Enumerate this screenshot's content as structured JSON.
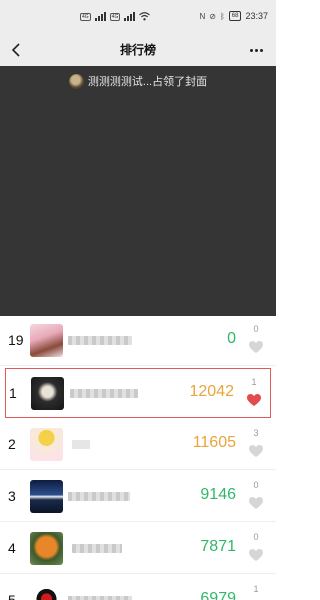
{
  "status_bar": {
    "sim1": "4G",
    "sim2": "4G",
    "battery": "68",
    "time": "23:37"
  },
  "nav": {
    "title": "排行榜",
    "back_icon": "chevron-left-icon",
    "more_icon": "more-dots-icon"
  },
  "cover": {
    "caption": "测测测测试...占领了封面",
    "background": "#353535"
  },
  "colors": {
    "orange": "#e9a43a",
    "green": "#2fb86a",
    "heart_active": "#e24c4c",
    "heart_inactive": "#d6d6d6",
    "highlight_border": "#e25a5a"
  },
  "ranking": [
    {
      "rank": "19",
      "steps": "0",
      "likes": "0",
      "liked": false,
      "highlighted": false,
      "color": "green"
    },
    {
      "rank": "1",
      "steps": "12042",
      "likes": "1",
      "liked": true,
      "highlighted": true,
      "color": "orange"
    },
    {
      "rank": "2",
      "steps": "11605",
      "likes": "3",
      "liked": false,
      "highlighted": false,
      "color": "orange"
    },
    {
      "rank": "3",
      "steps": "9146",
      "likes": "0",
      "liked": false,
      "highlighted": false,
      "color": "green"
    },
    {
      "rank": "4",
      "steps": "7871",
      "likes": "0",
      "liked": false,
      "highlighted": false,
      "color": "green"
    },
    {
      "rank": "5",
      "steps": "6979",
      "likes": "1",
      "liked": false,
      "highlighted": false,
      "color": "green"
    }
  ]
}
